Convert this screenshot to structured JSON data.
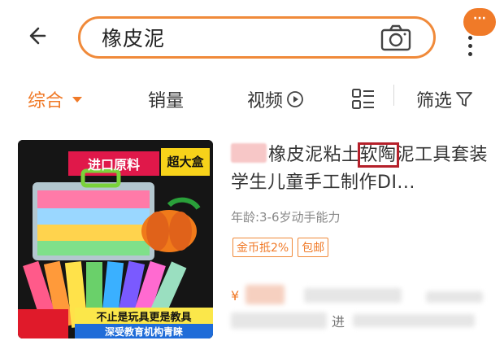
{
  "search": {
    "query": "橡皮泥"
  },
  "tabs": [
    {
      "label": "综合"
    },
    {
      "label": "销量"
    },
    {
      "label": "视频"
    },
    {
      "label": ""
    },
    {
      "label": "筛选"
    }
  ],
  "notifications": {
    "badge": "···"
  },
  "product": {
    "image_text": {
      "banner": "进口原料",
      "badge": "超大盒",
      "slogan": "不止是玩具更是教具",
      "footer": "深受教育机构青睐"
    },
    "title_part1": "橡皮泥粘土",
    "title_highlight": "软陶",
    "title_part2": "泥工具套装 学生儿童手工制作DI...",
    "subtitle": "年龄:3-6岁动手能力",
    "tags": [
      "金币抵2%",
      "包邮"
    ],
    "price_symbol": "¥",
    "shop_enter": "进"
  },
  "colors": {
    "accent": "#f07a28",
    "highlight_box": "#b5202a"
  }
}
